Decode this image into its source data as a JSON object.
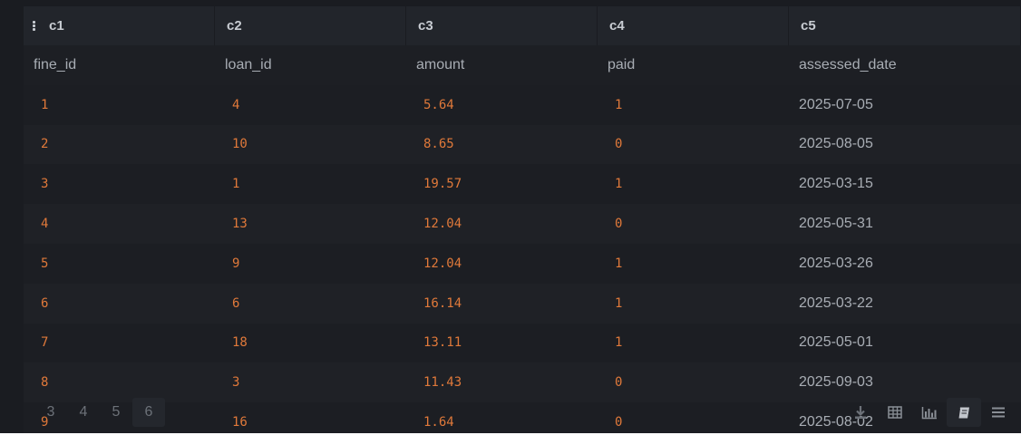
{
  "table": {
    "header": [
      "c1",
      "c2",
      "c3",
      "c4",
      "c5"
    ],
    "column_names": [
      "fine_id",
      "loan_id",
      "amount",
      "paid",
      "assessed_date"
    ],
    "rows": [
      [
        "1",
        "4",
        "5.64",
        "1",
        "2025-07-05"
      ],
      [
        "2",
        "10",
        "8.65",
        "0",
        "2025-08-05"
      ],
      [
        "3",
        "1",
        "19.57",
        "1",
        "2025-03-15"
      ],
      [
        "4",
        "13",
        "12.04",
        "0",
        "2025-05-31"
      ],
      [
        "5",
        "9",
        "12.04",
        "1",
        "2025-03-26"
      ],
      [
        "6",
        "6",
        "16.14",
        "1",
        "2025-03-22"
      ],
      [
        "7",
        "18",
        "13.11",
        "1",
        "2025-05-01"
      ],
      [
        "8",
        "3",
        "11.43",
        "0",
        "2025-09-03"
      ],
      [
        "9",
        "16",
        "1.64",
        "0",
        "2025-08-02"
      ]
    ]
  },
  "pagination": {
    "pages": [
      "3",
      "4",
      "5",
      "6"
    ],
    "active_page": "6"
  },
  "toolbar": {
    "icons": [
      "download-icon",
      "table-icon",
      "bar-chart-icon",
      "notebook-icon",
      "menu-icon"
    ],
    "active": "notebook-icon"
  },
  "colors": {
    "background": "#1a1c21",
    "numeric_text": "#e0793a",
    "text": "#a8adb4"
  }
}
